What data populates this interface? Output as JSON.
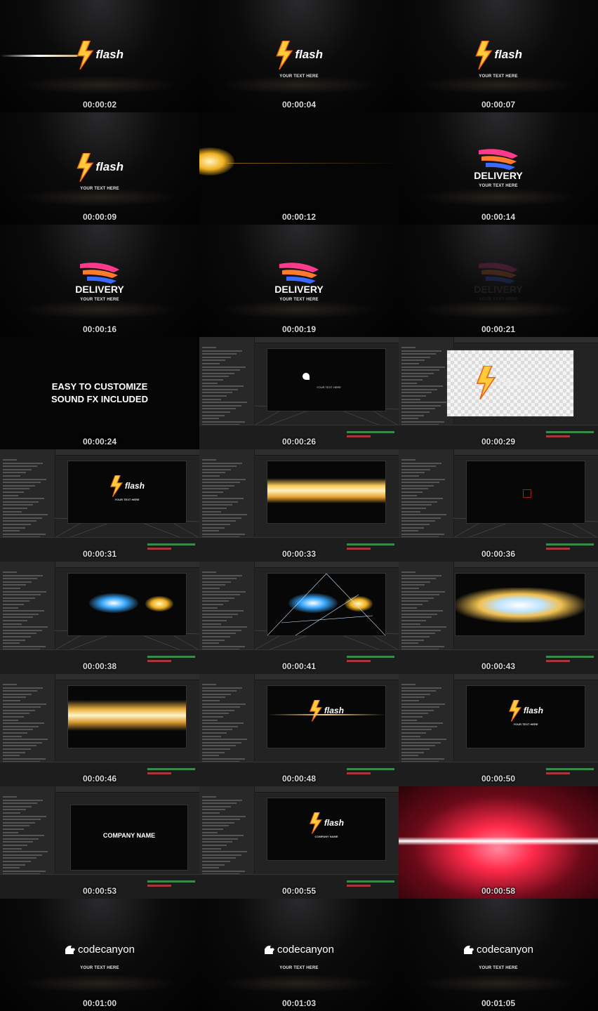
{
  "frames": [
    {
      "time": "00:00:02",
      "kind": "flash",
      "logo_text": "flash",
      "subtitle": ""
    },
    {
      "time": "00:00:04",
      "kind": "flash",
      "logo_text": "flash",
      "subtitle": "YOUR TEXT HERE"
    },
    {
      "time": "00:00:07",
      "kind": "flash",
      "logo_text": "flash",
      "subtitle": "YOUR TEXT HERE"
    },
    {
      "time": "00:00:09",
      "kind": "flash",
      "logo_text": "flash",
      "subtitle": "YOUR TEXT HERE"
    },
    {
      "time": "00:00:12",
      "kind": "flare"
    },
    {
      "time": "00:00:14",
      "kind": "delivery",
      "logo_text": "DELIVERY",
      "subtitle": "YOUR TEXT HERE"
    },
    {
      "time": "00:00:16",
      "kind": "delivery",
      "logo_text": "DELIVERY",
      "subtitle": "YOUR TEXT HERE"
    },
    {
      "time": "00:00:19",
      "kind": "delivery",
      "logo_text": "DELIVERY",
      "subtitle": "YOUR TEXT HERE"
    },
    {
      "time": "00:00:21",
      "kind": "delivery-fade",
      "logo_text": "DELIVERY",
      "subtitle": "YOUR TEXT HERE"
    },
    {
      "time": "00:00:24",
      "kind": "text",
      "lines": [
        "EASY TO CUSTOMIZE",
        "SOUND FX INCLUDED"
      ]
    },
    {
      "time": "00:00:26",
      "kind": "ae",
      "preview_text": "YOUR TEXT HERE"
    },
    {
      "time": "00:00:29",
      "kind": "ae-white",
      "logo_text": "flash"
    },
    {
      "time": "00:00:31",
      "kind": "ae-flash",
      "logo_text": "flash",
      "subtitle": "YOUR TEXT HERE"
    },
    {
      "time": "00:00:33",
      "kind": "ae-gold"
    },
    {
      "time": "00:00:36",
      "kind": "ae-dark"
    },
    {
      "time": "00:00:38",
      "kind": "ae-blue"
    },
    {
      "time": "00:00:41",
      "kind": "ae-blue-wire"
    },
    {
      "time": "00:00:43",
      "kind": "ae-streak"
    },
    {
      "time": "00:00:46",
      "kind": "ae-gold-wide"
    },
    {
      "time": "00:00:48",
      "kind": "ae-flash",
      "logo_text": "flash",
      "subtitle": ""
    },
    {
      "time": "00:00:50",
      "kind": "ae-flash",
      "logo_text": "flash",
      "subtitle": "YOUR TEXT HERE"
    },
    {
      "time": "00:00:53",
      "kind": "ae-company",
      "company": "COMPANY NAME"
    },
    {
      "time": "00:00:55",
      "kind": "ae-flash",
      "logo_text": "flash",
      "subtitle": "COMPANY NAME"
    },
    {
      "time": "00:00:58",
      "kind": "red-streak"
    },
    {
      "time": "00:01:00",
      "kind": "codecanyon",
      "logo_text": "codecanyon",
      "subtitle": "YOUR TEXT HERE"
    },
    {
      "time": "00:01:03",
      "kind": "codecanyon",
      "logo_text": "codecanyon",
      "subtitle": "YOUR TEXT HERE"
    },
    {
      "time": "00:01:05",
      "kind": "codecanyon",
      "logo_text": "codecanyon",
      "subtitle": "YOUR TEXT HERE"
    }
  ],
  "colors": {
    "flash_bolt_top": "#ffcb3a",
    "flash_bolt_bottom": "#e8661a",
    "delivery_top": "#ff3a8c",
    "delivery_mid": "#ff7a2a",
    "delivery_bottom": "#3a6aff",
    "red_streak": "#ff2a4a"
  },
  "icons": {
    "flash": "lightning-bolt-icon",
    "delivery": "delivery-wings-icon",
    "codecanyon": "codecanyon-leaf-icon"
  }
}
